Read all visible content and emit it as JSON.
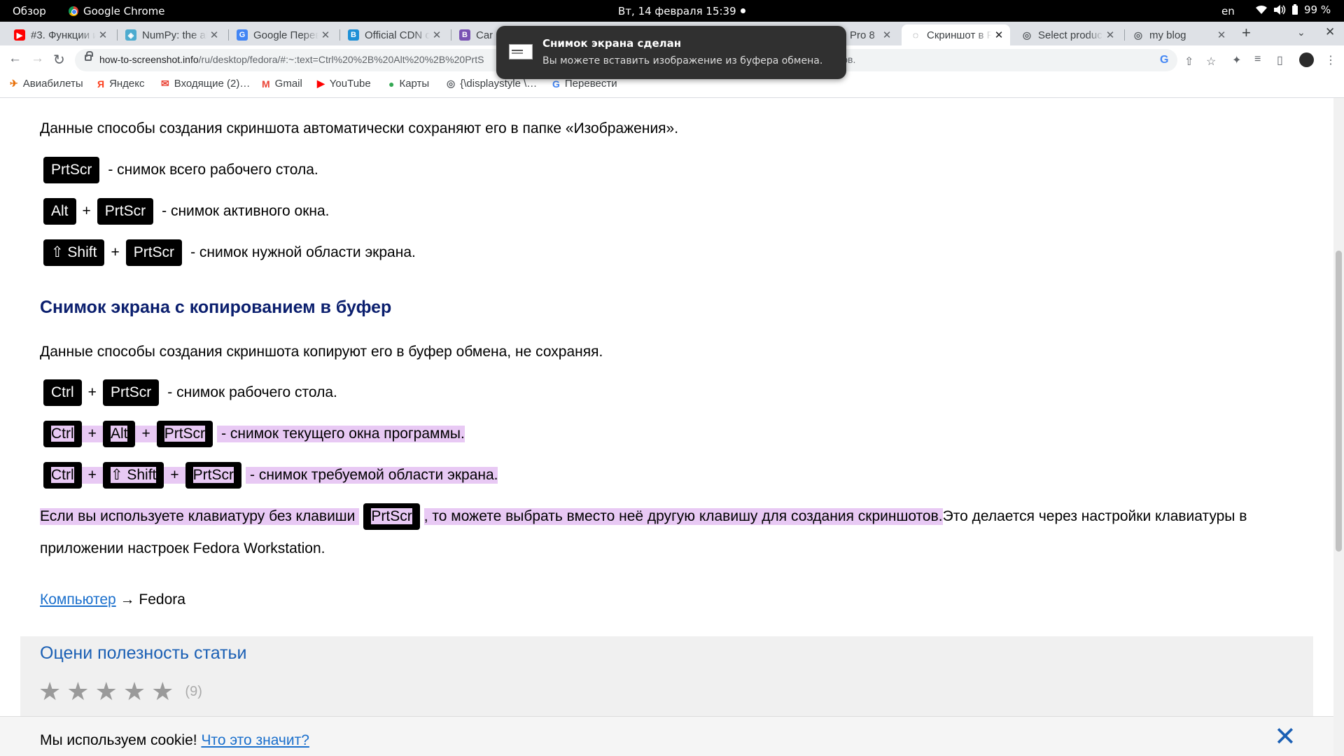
{
  "os": {
    "overview": "Обзор",
    "app_name": "Google Chrome",
    "clock": "Вт, 14 февраля  15:39",
    "lang": "en",
    "battery": "99 %"
  },
  "tabs": [
    {
      "title": "#3. Функции и",
      "fav_color": "#ff0000",
      "fav": "▶"
    },
    {
      "title": "NumPy: the ab",
      "fav_color": "#4dabcf",
      "fav": "◈"
    },
    {
      "title": "Google Перев",
      "fav_color": "#4285f4",
      "fav": "G"
    },
    {
      "title": "Official CDN o",
      "fav_color": "#1e90d6",
      "fav": "B"
    },
    {
      "title": "Car",
      "fav_color": "#7952b3",
      "fav": "B"
    },
    {
      "title": "Pro 8",
      "fav_color": "#dee1e6",
      "fav": ""
    },
    {
      "title": "Скриншот в F",
      "fav_color": "#5f6368",
      "fav": "◌"
    },
    {
      "title": "Select produc",
      "fav_color": "#5f6368",
      "fav": "◎"
    },
    {
      "title": "my blog",
      "fav_color": "#5f6368",
      "fav": "◎"
    }
  ],
  "omnibox": {
    "domain": "how-to-screenshot.info",
    "path": "/ru/desktop/fedora/#:~:text=Ctrl%20%2B%20Alt%20%2B%20PrtS",
    "tail": "тов."
  },
  "bookmarks": [
    {
      "label": "Авиабилеты",
      "icon": "✈",
      "color": "#e8710a"
    },
    {
      "label": "Яндекс",
      "icon": "Я",
      "color": "#fc3f1d"
    },
    {
      "label": "Входящие (2)…",
      "icon": "✉",
      "color": "#ea4335"
    },
    {
      "label": "Gmail",
      "icon": "M",
      "color": "#ea4335"
    },
    {
      "label": "YouTube",
      "icon": "▶",
      "color": "#ff0000"
    },
    {
      "label": "Карты",
      "icon": "●",
      "color": "#34a853"
    },
    {
      "label": "{\\displaystyle \\…",
      "icon": "◎",
      "color": "#5f6368"
    },
    {
      "label": "Перевести",
      "icon": "G",
      "color": "#4285f4"
    }
  ],
  "notification": {
    "title": "Снимок экрана сделан",
    "body": "Вы можете вставить изображение из буфера обмена."
  },
  "article": {
    "intro_save": "Данные способы создания скриншота автоматически сохраняют его в папке «Изображения».",
    "save_items": [
      {
        "keys": [
          "PrtScr"
        ],
        "desc": "- снимок всего рабочего стола."
      },
      {
        "keys": [
          "Alt",
          "PrtScr"
        ],
        "desc": "- снимок активного окна."
      },
      {
        "keys": [
          "⇧ Shift",
          "PrtScr"
        ],
        "desc": "- снимок нужной области экрана."
      }
    ],
    "heading_clipboard": "Снимок экрана с копированием в буфер",
    "intro_clip": "Данные способы создания скриншота копируют его в буфер обмена, не сохраняя.",
    "clip_items": [
      {
        "keys": [
          "Ctrl",
          "PrtScr"
        ],
        "desc": "- снимок рабочего стола."
      },
      {
        "keys": [
          "Ctrl",
          "Alt",
          "PrtScr"
        ],
        "desc": "- снимок текущего окна программы."
      },
      {
        "keys": [
          "Ctrl",
          "⇧ Shift",
          "PrtScr"
        ],
        "desc": "- снимок требуемой области экрана."
      }
    ],
    "plus": "+",
    "note_part1": "Если вы используете клавиатуру без клавиши",
    "note_key": "PrtScr",
    "note_part2": ", то можете выбрать вместо неё другую клавишу для создания скриншотов.",
    "note_part3": " Это делается через настройки клавиатуры в",
    "note_line2": "приложении настроек Fedora Workstation.",
    "crumb_link": "Компьютер",
    "crumb_arrow": "→",
    "crumb_current": "Fedora",
    "rating_title": "Оцени полезность статьи",
    "rating_count": "(9)",
    "rating_value": 0
  },
  "cookie": {
    "text": "Мы используем cookie!",
    "link": "Что это значит?"
  }
}
